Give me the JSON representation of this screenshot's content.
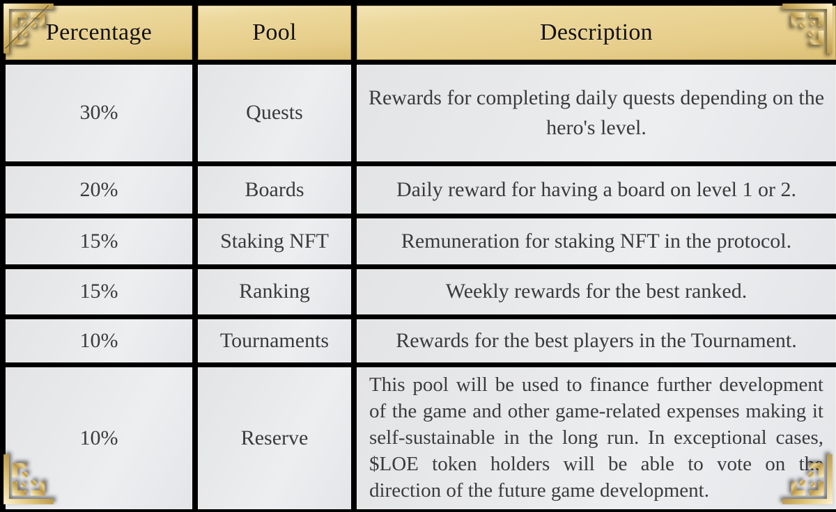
{
  "table": {
    "columns": [
      {
        "key": "percentage",
        "label": "Percentage"
      },
      {
        "key": "pool",
        "label": "Pool"
      },
      {
        "key": "description",
        "label": "Description"
      }
    ],
    "rows": [
      {
        "percentage": "30%",
        "pool": "Quests",
        "description": "Rewards for completing daily quests depending on the hero's level."
      },
      {
        "percentage": "20%",
        "pool": "Boards",
        "description": "Daily reward for having a board on level 1 or 2."
      },
      {
        "percentage": "15%",
        "pool": "Staking NFT",
        "description": "Remuneration for staking NFT in the protocol."
      },
      {
        "percentage": "15%",
        "pool": "Ranking",
        "description": "Weekly rewards for the best ranked."
      },
      {
        "percentage": "10%",
        "pool": "Tournaments",
        "description": "Rewards for the best players in the Tournament."
      },
      {
        "percentage": "10%",
        "pool": "Reserve",
        "description": "This pool will be used to finance further development of the game and other game-related expenses making it self-sustainable in the long run. In exceptional cases, $LOE token holders will be able to vote on the direction of the future game development."
      }
    ]
  },
  "ornaments": {
    "top_left": "celtic-knot-corner-icon",
    "top_right": "celtic-knot-corner-icon",
    "bottom_left": "celtic-knot-corner-icon",
    "bottom_right": "celtic-knot-corner-icon"
  },
  "colors": {
    "background": "#000000",
    "header_gold_light": "#f3e4b4",
    "header_gold_dark": "#ddc075",
    "header_border": "#b89b52",
    "cell_light": "#eceef0",
    "cell_dark": "#e3e4e6",
    "header_text": "#14100a",
    "body_text": "#3a3a3c",
    "ornament_gold": "#d8c07a"
  }
}
